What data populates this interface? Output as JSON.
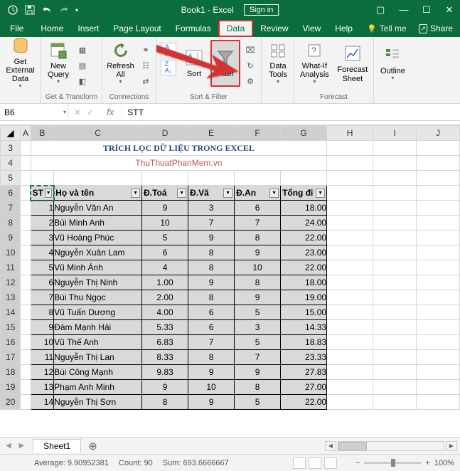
{
  "title": "Book1 - Excel",
  "signin": "Sign in",
  "tabs": [
    "File",
    "Home",
    "Insert",
    "Page Layout",
    "Formulas",
    "Data",
    "Review",
    "View",
    "Help"
  ],
  "active_tab": "Data",
  "tellme": "Tell me",
  "share": "Share",
  "ribbon": {
    "get_external": "Get External\nData",
    "new_query": "New\nQuery",
    "refresh_all": "Refresh\nAll",
    "sort": "Sort",
    "filter": "Filter",
    "data_tools": "Data\nTools",
    "whatif": "What-If\nAnalysis",
    "forecast_sheet": "Forecast\nSheet",
    "outline": "Outline",
    "grp_get_transform": "Get & Transform",
    "grp_connections": "Connections",
    "grp_sort_filter": "Sort & Filter",
    "grp_forecast": "Forecast"
  },
  "formula_bar": {
    "name_box": "B6",
    "formula": "STT"
  },
  "columns": [
    "A",
    "B",
    "C",
    "D",
    "E",
    "F",
    "G",
    "H",
    "I",
    "J"
  ],
  "title_row": "TRÍCH LỌC DỮ LIỆU TRONG EXCEL",
  "subtitle_row": "ThuThuatPhanMem.vn",
  "headers": [
    "STT",
    "Họ và tên",
    "Đ.Toán",
    "Đ.Văn",
    "Đ.Anh",
    "Tổng điểm"
  ],
  "headers_display": [
    "ST",
    "Họ và tên",
    "Đ.Toá",
    "Đ.Vă",
    "Đ.An",
    "Tổng đi"
  ],
  "rows": [
    {
      "stt": 1,
      "name": "Nguyễn Văn An",
      "t": "9",
      "v": "3",
      "a": "6",
      "sum": "18.00"
    },
    {
      "stt": 2,
      "name": "Bùi Minh Anh",
      "t": "10",
      "v": "7",
      "a": "7",
      "sum": "24.00"
    },
    {
      "stt": 3,
      "name": "Vũ Hoàng Phúc",
      "t": "5",
      "v": "9",
      "a": "8",
      "sum": "22.00"
    },
    {
      "stt": 4,
      "name": "Nguyễn Xuân Lam",
      "t": "6",
      "v": "8",
      "a": "9",
      "sum": "23.00"
    },
    {
      "stt": 5,
      "name": "Vũ Minh Ánh",
      "t": "4",
      "v": "8",
      "a": "10",
      "sum": "22.00"
    },
    {
      "stt": 6,
      "name": "Nguyễn Thị Ninh",
      "t": "1.00",
      "v": "9",
      "a": "8",
      "sum": "18.00"
    },
    {
      "stt": 7,
      "name": "Bùi Thu Ngọc",
      "t": "2.00",
      "v": "8",
      "a": "9",
      "sum": "19.00"
    },
    {
      "stt": 8,
      "name": "Vũ Tuấn Dương",
      "t": "4.00",
      "v": "6",
      "a": "5",
      "sum": "15.00"
    },
    {
      "stt": 9,
      "name": "Đàm Mạnh Hải",
      "t": "5.33",
      "v": "6",
      "a": "3",
      "sum": "14.33"
    },
    {
      "stt": 10,
      "name": "Vũ Thế Anh",
      "t": "6.83",
      "v": "7",
      "a": "5",
      "sum": "18.83"
    },
    {
      "stt": 11,
      "name": "Nguyễn Thị Lan",
      "t": "8.33",
      "v": "8",
      "a": "7",
      "sum": "23.33"
    },
    {
      "stt": 12,
      "name": "Bùi Công Mạnh",
      "t": "9.83",
      "v": "9",
      "a": "9",
      "sum": "27.83"
    },
    {
      "stt": 13,
      "name": "Phạm Anh Minh",
      "t": "9",
      "v": "10",
      "a": "8",
      "sum": "27.00"
    },
    {
      "stt": 14,
      "name": "Nguyễn Thị Sơn",
      "t": "8",
      "v": "9",
      "a": "5",
      "sum": "22.00"
    }
  ],
  "row_numbers": [
    3,
    4,
    5,
    6,
    7,
    8,
    9,
    10,
    11,
    12,
    13,
    14,
    15,
    16,
    17,
    18,
    19,
    20
  ],
  "sheet": {
    "active": "Sheet1"
  },
  "status": {
    "avg_label": "Average:",
    "avg": "9.90952381",
    "count_label": "Count:",
    "count": "90",
    "sum_label": "Sum:",
    "sum": "693.6666667",
    "zoom": "100%"
  }
}
